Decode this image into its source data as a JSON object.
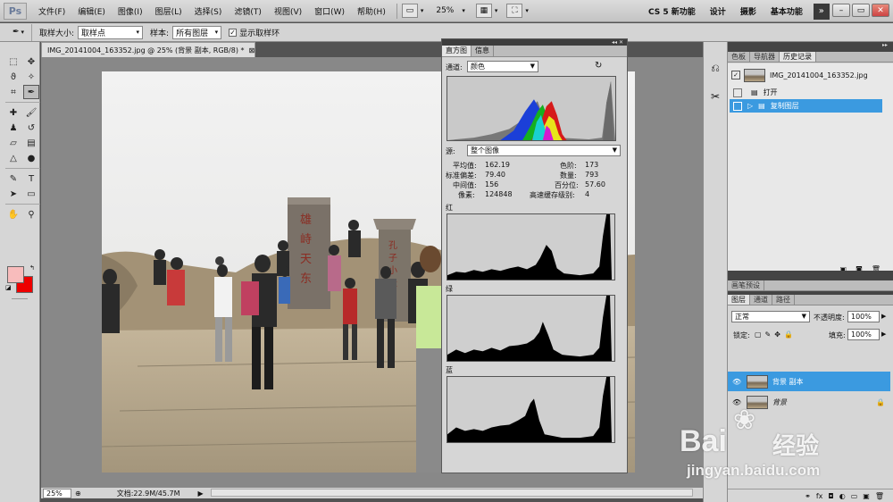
{
  "app": {
    "logo": "Ps"
  },
  "menu": [
    "文件(F)",
    "编辑(E)",
    "图像(I)",
    "图层(L)",
    "选择(S)",
    "滤镜(T)",
    "视图(V)",
    "窗口(W)",
    "帮助(H)"
  ],
  "menubar": {
    "zoom": "25%"
  },
  "workspaces": [
    "CS 5 新功能",
    "设计",
    "摄影",
    "基本功能"
  ],
  "options": {
    "sample_size_label": "取样大小:",
    "sample_size_value": "取样点",
    "sample_label": "样本:",
    "sample_value": "所有图层",
    "ring_label": "显示取样环",
    "ring_checked": true
  },
  "document": {
    "tab_title": "IMG_20141004_163352.jpg @ 25% (背景 副本, RGB/8) *",
    "zoom": "25%",
    "doc_size": "文档:22.9M/45.7M"
  },
  "colors": {
    "foreground": "#f8bcbc",
    "background": "#ee0000",
    "accent": "#3b9ae0"
  },
  "histogram": {
    "tabs": [
      "直方图",
      "信息"
    ],
    "channel_label": "通道:",
    "channel_value": "颜色",
    "source_label": "源:",
    "source_value": "整个图像",
    "stats": {
      "mean_label": "平均值:",
      "mean": "162.19",
      "stddev_label": "标准偏差:",
      "stddev": "79.40",
      "median_label": "中间值:",
      "median": "156",
      "pixels_label": "像素:",
      "pixels": "124848",
      "level_label": "色阶:",
      "level": "173",
      "count_label": "数量:",
      "count": "793",
      "percentile_label": "百分位:",
      "percentile": "57.60",
      "cache_label": "高速缓存级别:",
      "cache": "4"
    },
    "channels": [
      "红",
      "绿",
      "蓝"
    ]
  },
  "right_panel": {
    "top_tabs": [
      "色板",
      "导航器",
      "历史记录"
    ],
    "history": [
      {
        "label": "IMG_20141004_163352.jpg",
        "type": "snapshot"
      },
      {
        "label": "打开",
        "type": "step"
      },
      {
        "label": "复制图层",
        "type": "step",
        "selected": true
      }
    ],
    "brush_presets_tab": "画笔预设",
    "layer_tabs": [
      "图层",
      "通道",
      "路径"
    ],
    "blend_mode": "正常",
    "opacity_label": "不透明度:",
    "opacity": "100%",
    "lock_label": "锁定:",
    "fill_label": "填充:",
    "fill": "100%",
    "layers": [
      {
        "name": "背景 副本",
        "selected": true
      },
      {
        "name": "背景",
        "selected": false,
        "locked": true
      }
    ]
  },
  "photo_signs": {
    "left_stone": "雄峙天东",
    "right_stone": "孔子小天下"
  },
  "watermark": {
    "brand": "Bai",
    "brand2": "经验",
    "url": "jingyan.baidu.com"
  }
}
